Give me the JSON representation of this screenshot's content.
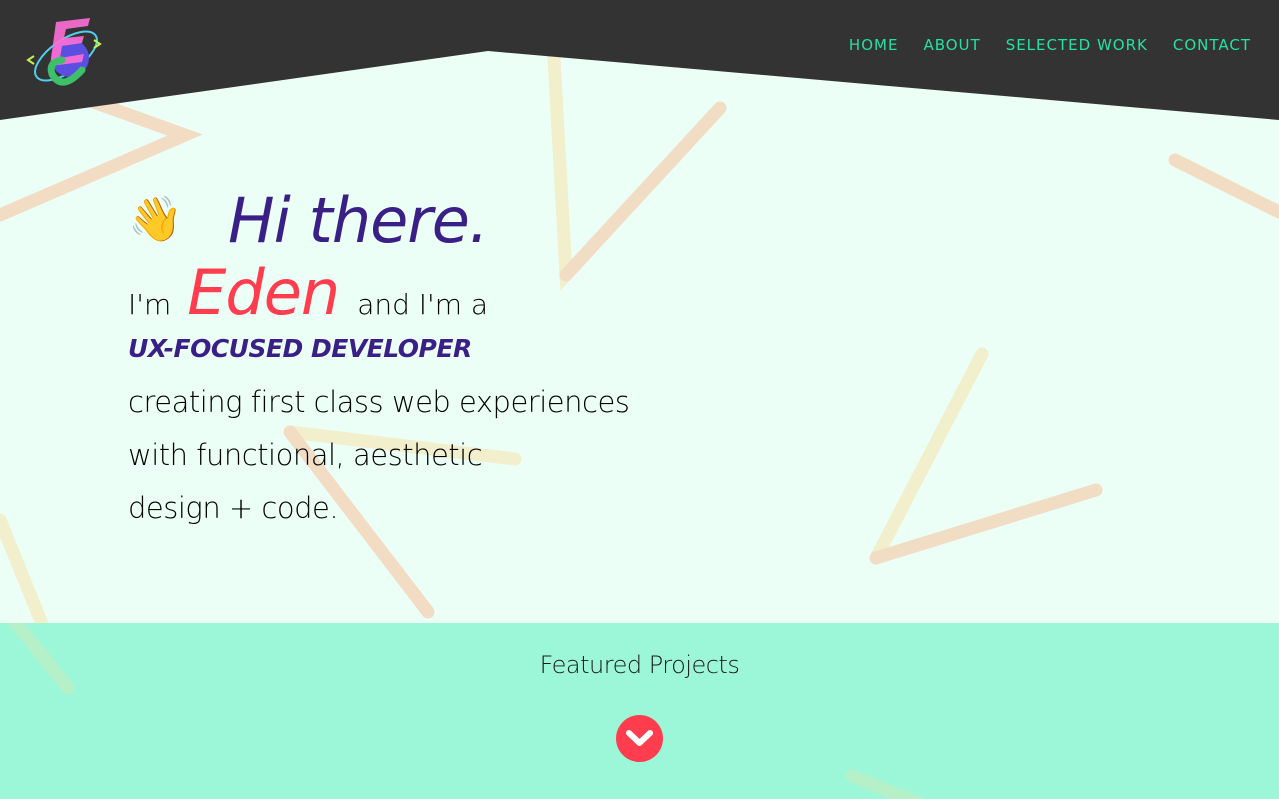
{
  "header": {
    "logo_icon": "ec-logo-icon",
    "nav": [
      {
        "label": "HOME"
      },
      {
        "label": "ABOUT"
      },
      {
        "label": "SELECTED WORK"
      },
      {
        "label": "CONTACT"
      }
    ],
    "background_color": "#333333",
    "nav_color": "#22e3a0"
  },
  "hero": {
    "wave_emoji": "👋",
    "greeting": "Hi there.",
    "im_prefix": "I'm",
    "name": "Eden",
    "im_suffix": "and I'm a",
    "role": "UX-FOCUSED DEVELOPER",
    "desc_line1": "creating first class web experiences",
    "desc_line2": "with functional, aesthetic",
    "desc_line3": "design + code.",
    "accent_purple": "#3a1f86",
    "accent_red": "#ff3d4f"
  },
  "featured": {
    "title": "Featured Projects",
    "scroll_icon": "chevron-down-icon",
    "background_color": "#9cf7d8"
  }
}
